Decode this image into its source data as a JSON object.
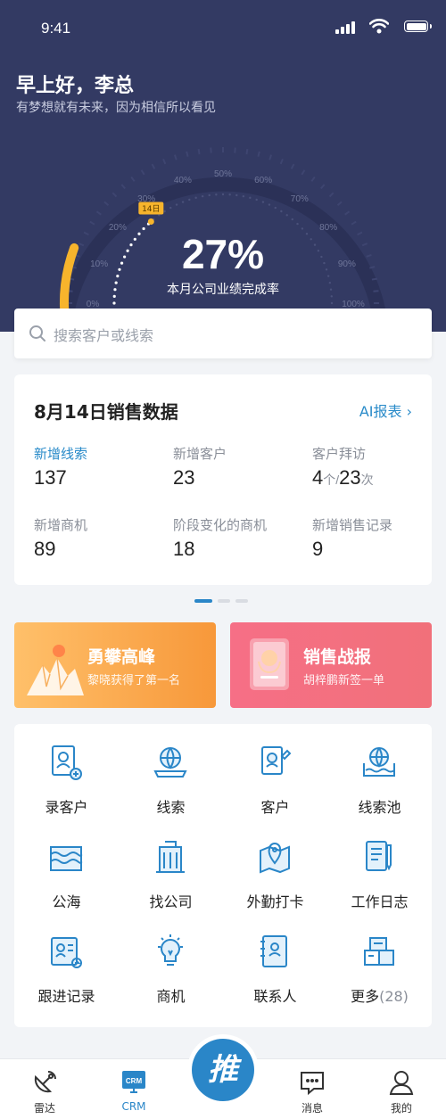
{
  "status": {
    "time": "9:41"
  },
  "header": {
    "greeting": "早上好，李总",
    "motto": "有梦想就有未来，因为相信所以看见"
  },
  "gauge": {
    "value_text": "27%",
    "value": 27,
    "label": "本月公司业绩完成率",
    "marker": "14日",
    "ticks": [
      "0%",
      "10%",
      "20%",
      "30%",
      "40%",
      "50%",
      "60%",
      "70%",
      "80%",
      "90%",
      "100%"
    ],
    "colors": {
      "fill": "#f7b42c",
      "track": "#2b3157"
    }
  },
  "search": {
    "placeholder": "搜索客户或线索"
  },
  "sales": {
    "title": "8月14日销售数据",
    "report_link": "AI报表 ›",
    "stats": [
      {
        "label": "新增线索",
        "value": "137"
      },
      {
        "label": "新增客户",
        "value": "23"
      },
      {
        "label": "客户拜访",
        "value": "4",
        "unit1": "个/",
        "value2": "23",
        "unit2": "次"
      },
      {
        "label": "新增商机",
        "value": "89"
      },
      {
        "label": "阶段变化的商机",
        "value": "18"
      },
      {
        "label": "新增销售记录",
        "value": "9"
      }
    ]
  },
  "banners": [
    {
      "title": "勇攀高峰",
      "subtitle": "黎晓获得了第一名",
      "icon": "mountain-icon"
    },
    {
      "title": "销售战报",
      "subtitle": "胡梓鹏新签一单",
      "icon": "award-certificate-icon"
    }
  ],
  "features": [
    {
      "label": "录客户",
      "icon": "add-customer-icon"
    },
    {
      "label": "线索",
      "icon": "globe-laptop-icon"
    },
    {
      "label": "客户",
      "icon": "customer-icon"
    },
    {
      "label": "线索池",
      "icon": "globe-pool-icon"
    },
    {
      "label": "公海",
      "icon": "sea-icon"
    },
    {
      "label": "找公司",
      "icon": "building-icon"
    },
    {
      "label": "外勤打卡",
      "icon": "map-pin-icon"
    },
    {
      "label": "工作日志",
      "icon": "notebook-pen-icon"
    },
    {
      "label": "跟进记录",
      "icon": "follow-record-icon"
    },
    {
      "label": "商机",
      "icon": "lightbulb-icon"
    },
    {
      "label": "联系人",
      "icon": "contacts-book-icon"
    },
    {
      "label": "更多",
      "count": "(28)",
      "icon": "boxes-icon"
    }
  ],
  "tabbar": {
    "items": [
      {
        "label": "雷达",
        "icon": "radar-icon"
      },
      {
        "label": "CRM",
        "icon": "crm-icon",
        "active": true
      },
      {
        "label": "消息",
        "icon": "message-icon"
      },
      {
        "label": "我的",
        "icon": "profile-icon"
      }
    ],
    "push_label": "推"
  },
  "colors": {
    "accent": "#2a8bc9",
    "hero_bg": "#333a63",
    "orange": "#f7a23e",
    "red": "#f46b7a"
  }
}
